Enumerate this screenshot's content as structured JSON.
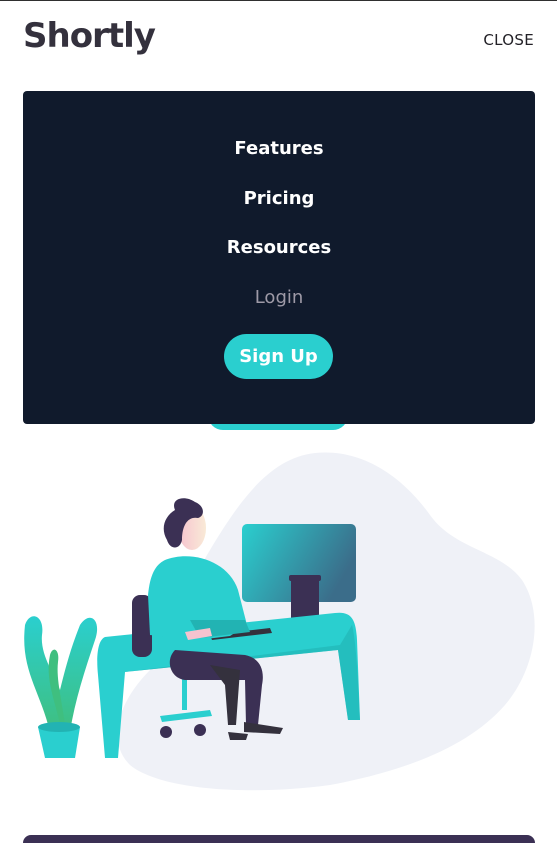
{
  "header": {
    "logo_text": "Shortly",
    "close_label": "CLOSE"
  },
  "menu": {
    "items": [
      {
        "label": "Features"
      },
      {
        "label": "Pricing"
      },
      {
        "label": "Resources"
      },
      {
        "label": "Login"
      }
    ],
    "signup_label": "Sign Up"
  },
  "illustration": {
    "icon": "person-working-illustration"
  },
  "colors": {
    "brand_cyan": "#2acfcf",
    "menu_bg": "#101a2c",
    "dark_violet": "#3b3054",
    "text_dark": "#34313d",
    "muted": "#9e9aa7"
  }
}
